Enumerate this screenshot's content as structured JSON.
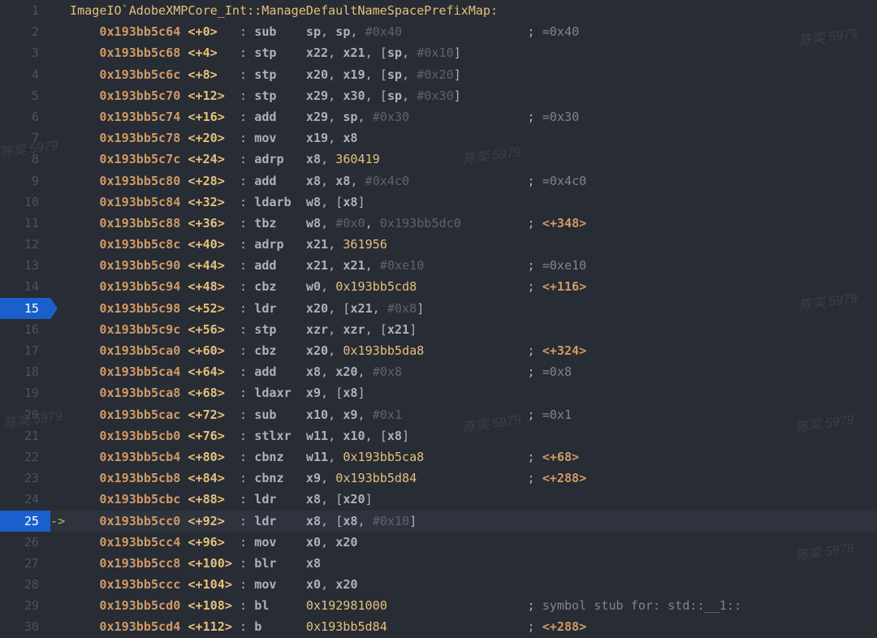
{
  "title": "ImageIO`AdobeXMPCore_Int::ManageDefaultNameSpacePrefixMap:",
  "watermark_text": "陈奕 5979",
  "breakpoints": [
    15,
    25
  ],
  "current_line": 25,
  "lines": [
    {
      "n": 1,
      "kind": "title"
    },
    {
      "n": 2,
      "addr": "0x193bb5c64",
      "off": "+0",
      "mnem": "sub",
      "ops": [
        {
          "t": "reg",
          "v": "sp"
        },
        {
          "t": "p",
          "v": ", "
        },
        {
          "t": "reg",
          "v": "sp"
        },
        {
          "t": "p",
          "v": ", "
        },
        {
          "t": "immh",
          "v": "#0x40"
        }
      ],
      "cmt": "=0x40"
    },
    {
      "n": 3,
      "addr": "0x193bb5c68",
      "off": "+4",
      "mnem": "stp",
      "ops": [
        {
          "t": "reg",
          "v": "x22"
        },
        {
          "t": "p",
          "v": ", "
        },
        {
          "t": "reg",
          "v": "x21"
        },
        {
          "t": "p",
          "v": ", ["
        },
        {
          "t": "reg",
          "v": "sp"
        },
        {
          "t": "p",
          "v": ", "
        },
        {
          "t": "immh",
          "v": "#0x10"
        },
        {
          "t": "p",
          "v": "]"
        }
      ]
    },
    {
      "n": 4,
      "addr": "0x193bb5c6c",
      "off": "+8",
      "mnem": "stp",
      "ops": [
        {
          "t": "reg",
          "v": "x20"
        },
        {
          "t": "p",
          "v": ", "
        },
        {
          "t": "reg",
          "v": "x19"
        },
        {
          "t": "p",
          "v": ", ["
        },
        {
          "t": "reg",
          "v": "sp"
        },
        {
          "t": "p",
          "v": ", "
        },
        {
          "t": "immh",
          "v": "#0x20"
        },
        {
          "t": "p",
          "v": "]"
        }
      ]
    },
    {
      "n": 5,
      "addr": "0x193bb5c70",
      "off": "+12",
      "mnem": "stp",
      "ops": [
        {
          "t": "reg",
          "v": "x29"
        },
        {
          "t": "p",
          "v": ", "
        },
        {
          "t": "reg",
          "v": "x30"
        },
        {
          "t": "p",
          "v": ", ["
        },
        {
          "t": "reg",
          "v": "sp"
        },
        {
          "t": "p",
          "v": ", "
        },
        {
          "t": "immh",
          "v": "#0x30"
        },
        {
          "t": "p",
          "v": "]"
        }
      ]
    },
    {
      "n": 6,
      "addr": "0x193bb5c74",
      "off": "+16",
      "mnem": "add",
      "ops": [
        {
          "t": "reg",
          "v": "x29"
        },
        {
          "t": "p",
          "v": ", "
        },
        {
          "t": "reg",
          "v": "sp"
        },
        {
          "t": "p",
          "v": ", "
        },
        {
          "t": "immh",
          "v": "#0x30"
        }
      ],
      "cmt": "=0x30"
    },
    {
      "n": 7,
      "addr": "0x193bb5c78",
      "off": "+20",
      "mnem": "mov",
      "ops": [
        {
          "t": "reg",
          "v": "x19"
        },
        {
          "t": "p",
          "v": ", "
        },
        {
          "t": "reg",
          "v": "x8"
        }
      ]
    },
    {
      "n": 8,
      "addr": "0x193bb5c7c",
      "off": "+24",
      "mnem": "adrp",
      "ops": [
        {
          "t": "reg",
          "v": "x8"
        },
        {
          "t": "p",
          "v": ", "
        },
        {
          "t": "imm",
          "v": "360419"
        }
      ]
    },
    {
      "n": 9,
      "addr": "0x193bb5c80",
      "off": "+28",
      "mnem": "add",
      "ops": [
        {
          "t": "reg",
          "v": "x8"
        },
        {
          "t": "p",
          "v": ", "
        },
        {
          "t": "reg",
          "v": "x8"
        },
        {
          "t": "p",
          "v": ", "
        },
        {
          "t": "immh",
          "v": "#0x4c0"
        }
      ],
      "cmt": "=0x4c0"
    },
    {
      "n": 10,
      "addr": "0x193bb5c84",
      "off": "+32",
      "mnem": "ldarb",
      "ops": [
        {
          "t": "reg",
          "v": "w8"
        },
        {
          "t": "p",
          "v": ", ["
        },
        {
          "t": "reg",
          "v": "x8"
        },
        {
          "t": "p",
          "v": "]"
        }
      ]
    },
    {
      "n": 11,
      "addr": "0x193bb5c88",
      "off": "+36",
      "mnem": "tbz",
      "ops": [
        {
          "t": "reg",
          "v": "w8"
        },
        {
          "t": "p",
          "v": ", "
        },
        {
          "t": "immh",
          "v": "#0x0"
        },
        {
          "t": "p",
          "v": ", "
        },
        {
          "t": "immh",
          "v": "0x193bb5dc0"
        }
      ],
      "cmt": "<+348>",
      "chl": true
    },
    {
      "n": 12,
      "addr": "0x193bb5c8c",
      "off": "+40",
      "mnem": "adrp",
      "ops": [
        {
          "t": "reg",
          "v": "x21"
        },
        {
          "t": "p",
          "v": ", "
        },
        {
          "t": "imm",
          "v": "361956"
        }
      ]
    },
    {
      "n": 13,
      "addr": "0x193bb5c90",
      "off": "+44",
      "mnem": "add",
      "ops": [
        {
          "t": "reg",
          "v": "x21"
        },
        {
          "t": "p",
          "v": ", "
        },
        {
          "t": "reg",
          "v": "x21"
        },
        {
          "t": "p",
          "v": ", "
        },
        {
          "t": "immh",
          "v": "#0xe10"
        }
      ],
      "cmt": "=0xe10"
    },
    {
      "n": 14,
      "addr": "0x193bb5c94",
      "off": "+48",
      "mnem": "cbz",
      "ops": [
        {
          "t": "reg",
          "v": "w0"
        },
        {
          "t": "p",
          "v": ", "
        },
        {
          "t": "imm",
          "v": "0x193bb5cd8"
        }
      ],
      "cmt": "<+116>",
      "chl": true
    },
    {
      "n": 15,
      "addr": "0x193bb5c98",
      "off": "+52",
      "mnem": "ldr",
      "ops": [
        {
          "t": "reg",
          "v": "x20"
        },
        {
          "t": "p",
          "v": ", ["
        },
        {
          "t": "reg",
          "v": "x21"
        },
        {
          "t": "p",
          "v": ", "
        },
        {
          "t": "immh",
          "v": "#0x8"
        },
        {
          "t": "p",
          "v": "]"
        }
      ]
    },
    {
      "n": 16,
      "addr": "0x193bb5c9c",
      "off": "+56",
      "mnem": "stp",
      "ops": [
        {
          "t": "reg",
          "v": "xzr"
        },
        {
          "t": "p",
          "v": ", "
        },
        {
          "t": "reg",
          "v": "xzr"
        },
        {
          "t": "p",
          "v": ", ["
        },
        {
          "t": "reg",
          "v": "x21"
        },
        {
          "t": "p",
          "v": "]"
        }
      ]
    },
    {
      "n": 17,
      "addr": "0x193bb5ca0",
      "off": "+60",
      "mnem": "cbz",
      "ops": [
        {
          "t": "reg",
          "v": "x20"
        },
        {
          "t": "p",
          "v": ", "
        },
        {
          "t": "imm",
          "v": "0x193bb5da8"
        }
      ],
      "cmt": "<+324>",
      "chl": true
    },
    {
      "n": 18,
      "addr": "0x193bb5ca4",
      "off": "+64",
      "mnem": "add",
      "ops": [
        {
          "t": "reg",
          "v": "x8"
        },
        {
          "t": "p",
          "v": ", "
        },
        {
          "t": "reg",
          "v": "x20"
        },
        {
          "t": "p",
          "v": ", "
        },
        {
          "t": "immh",
          "v": "#0x8"
        }
      ],
      "cmt": "=0x8"
    },
    {
      "n": 19,
      "addr": "0x193bb5ca8",
      "off": "+68",
      "mnem": "ldaxr",
      "ops": [
        {
          "t": "reg",
          "v": "x9"
        },
        {
          "t": "p",
          "v": ", ["
        },
        {
          "t": "reg",
          "v": "x8"
        },
        {
          "t": "p",
          "v": "]"
        }
      ]
    },
    {
      "n": 20,
      "addr": "0x193bb5cac",
      "off": "+72",
      "mnem": "sub",
      "ops": [
        {
          "t": "reg",
          "v": "x10"
        },
        {
          "t": "p",
          "v": ", "
        },
        {
          "t": "reg",
          "v": "x9"
        },
        {
          "t": "p",
          "v": ", "
        },
        {
          "t": "immh",
          "v": "#0x1"
        }
      ],
      "cmt": "=0x1"
    },
    {
      "n": 21,
      "addr": "0x193bb5cb0",
      "off": "+76",
      "mnem": "stlxr",
      "ops": [
        {
          "t": "reg",
          "v": "w11"
        },
        {
          "t": "p",
          "v": ", "
        },
        {
          "t": "reg",
          "v": "x10"
        },
        {
          "t": "p",
          "v": ", ["
        },
        {
          "t": "reg",
          "v": "x8"
        },
        {
          "t": "p",
          "v": "]"
        }
      ]
    },
    {
      "n": 22,
      "addr": "0x193bb5cb4",
      "off": "+80",
      "mnem": "cbnz",
      "ops": [
        {
          "t": "reg",
          "v": "w11"
        },
        {
          "t": "p",
          "v": ", "
        },
        {
          "t": "imm",
          "v": "0x193bb5ca8"
        }
      ],
      "cmt": "<+68>",
      "chl": true
    },
    {
      "n": 23,
      "addr": "0x193bb5cb8",
      "off": "+84",
      "mnem": "cbnz",
      "ops": [
        {
          "t": "reg",
          "v": "x9"
        },
        {
          "t": "p",
          "v": ", "
        },
        {
          "t": "imm",
          "v": "0x193bb5d84"
        }
      ],
      "cmt": "<+288>",
      "chl": true
    },
    {
      "n": 24,
      "addr": "0x193bb5cbc",
      "off": "+88",
      "mnem": "ldr",
      "ops": [
        {
          "t": "reg",
          "v": "x8"
        },
        {
          "t": "p",
          "v": ", ["
        },
        {
          "t": "reg",
          "v": "x20"
        },
        {
          "t": "p",
          "v": "]"
        }
      ]
    },
    {
      "n": 25,
      "addr": "0x193bb5cc0",
      "off": "+92",
      "mnem": "ldr",
      "ops": [
        {
          "t": "reg",
          "v": "x8"
        },
        {
          "t": "p",
          "v": ", ["
        },
        {
          "t": "reg",
          "v": "x8"
        },
        {
          "t": "p",
          "v": ", "
        },
        {
          "t": "immh",
          "v": "#0x10"
        },
        {
          "t": "p",
          "v": "]"
        }
      ]
    },
    {
      "n": 26,
      "addr": "0x193bb5cc4",
      "off": "+96",
      "mnem": "mov",
      "ops": [
        {
          "t": "reg",
          "v": "x0"
        },
        {
          "t": "p",
          "v": ", "
        },
        {
          "t": "reg",
          "v": "x20"
        }
      ]
    },
    {
      "n": 27,
      "addr": "0x193bb5cc8",
      "off": "+100",
      "mnem": "blr",
      "ops": [
        {
          "t": "reg",
          "v": "x8"
        }
      ]
    },
    {
      "n": 28,
      "addr": "0x193bb5ccc",
      "off": "+104",
      "mnem": "mov",
      "ops": [
        {
          "t": "reg",
          "v": "x0"
        },
        {
          "t": "p",
          "v": ", "
        },
        {
          "t": "reg",
          "v": "x20"
        }
      ]
    },
    {
      "n": 29,
      "addr": "0x193bb5cd0",
      "off": "+108",
      "mnem": "bl",
      "ops": [
        {
          "t": "imm",
          "v": "0x192981000"
        }
      ],
      "cmt": "symbol stub for: std::__1::"
    },
    {
      "n": 30,
      "addr": "0x193bb5cd4",
      "off": "+112",
      "mnem": "b",
      "ops": [
        {
          "t": "imm",
          "v": "0x193bb5d84"
        }
      ],
      "cmt": "<+288>",
      "chl": true
    }
  ],
  "layout": {
    "mnem_w": 7,
    "ops_w": 30,
    "off_w": 7
  }
}
